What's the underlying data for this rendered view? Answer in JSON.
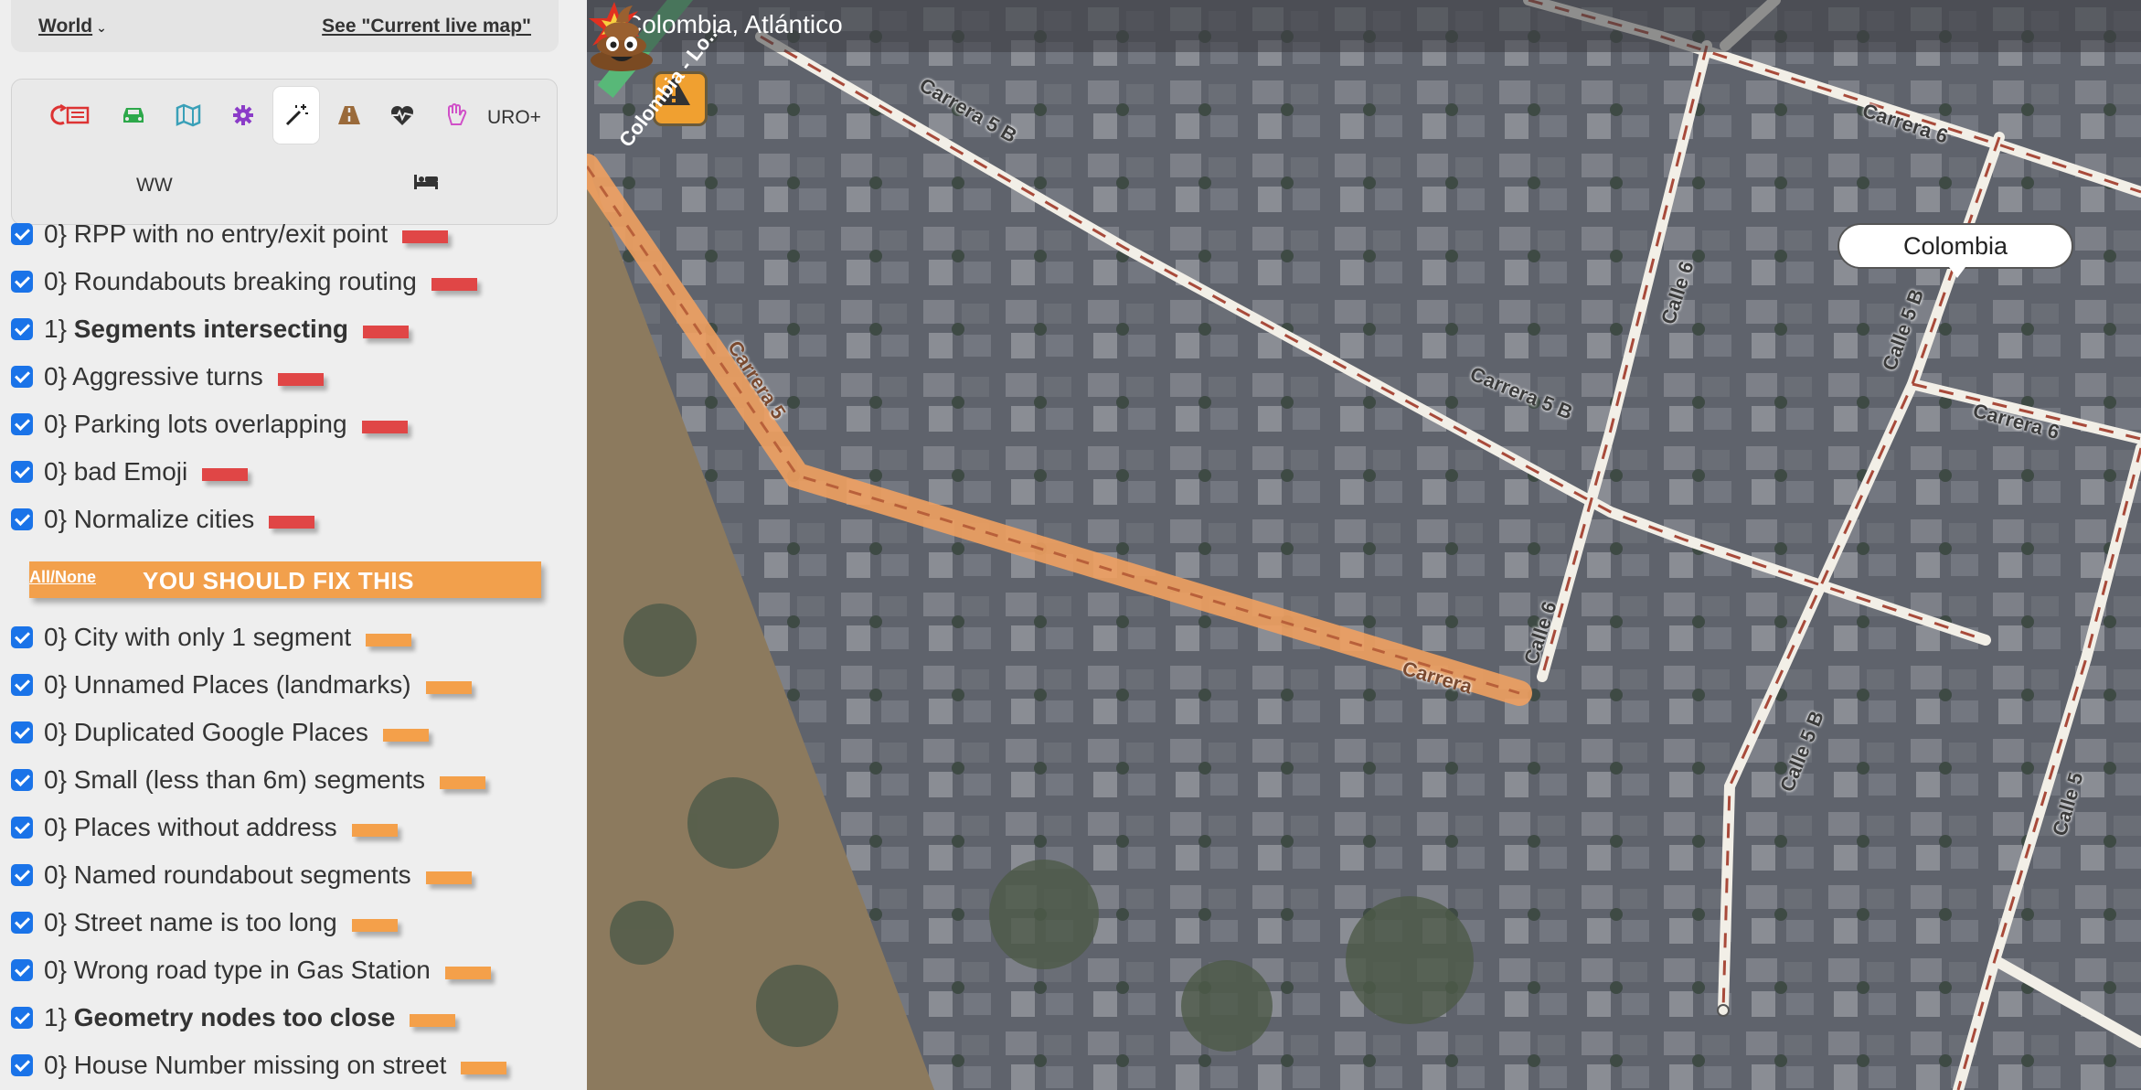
{
  "topbar": {
    "world_label": "World",
    "live_map_link": "See \"Current live map\""
  },
  "toolbar": {
    "icons": [
      "restart-icon",
      "car-icon",
      "map-icon",
      "gear-icon",
      "magic-wand-icon",
      "road-icon",
      "heartbeat-icon",
      "hand-icon"
    ],
    "uro_label": "URO+",
    "ww_label": "WW",
    "active_tool": "magic-wand-icon"
  },
  "checks": [
    {
      "label": "0} RPP with no entry/exit point",
      "bold": false,
      "color": "red"
    },
    {
      "label": "0} Roundabouts breaking routing",
      "bold": false,
      "color": "red"
    },
    {
      "label_count": "1}",
      "label": "Segments intersecting",
      "bold": true,
      "color": "red"
    },
    {
      "label": "0} Aggressive turns",
      "bold": false,
      "color": "red"
    },
    {
      "label": "0} Parking lots overlapping",
      "bold": false,
      "color": "red"
    },
    {
      "label": "0} bad Emoji",
      "bold": false,
      "color": "red"
    },
    {
      "label": "0} Normalize cities",
      "bold": false,
      "color": "red"
    }
  ],
  "fix_section": {
    "all_none": "All/None",
    "title": "YOU SHOULD FIX THIS"
  },
  "fix_checks": [
    {
      "label": "0} City with only 1 segment",
      "bold": false,
      "color": "orange"
    },
    {
      "label": "0} Unnamed Places (landmarks)",
      "bold": false,
      "color": "orange"
    },
    {
      "label": "0} Duplicated Google Places",
      "bold": false,
      "color": "orange"
    },
    {
      "label": "0} Small (less than 6m) segments",
      "bold": false,
      "color": "orange"
    },
    {
      "label": "0} Places without address",
      "bold": false,
      "color": "orange"
    },
    {
      "label": "0} Named roundabout segments",
      "bold": false,
      "color": "orange"
    },
    {
      "label": "0} Street name is too long",
      "bold": false,
      "color": "orange"
    },
    {
      "label": "0} Wrong road type in Gas Station",
      "bold": false,
      "color": "orange"
    },
    {
      "label_count": "1}",
      "label": "Geometry nodes too close",
      "bold": true,
      "color": "orange"
    },
    {
      "label": "0} House Number missing on street",
      "bold": false,
      "color": "orange"
    }
  ],
  "map": {
    "location_title": "Colombia, Atlántico",
    "country_bubble": "Colombia",
    "street_labels": [
      "Carrera 5 B",
      "Carrera 6",
      "Carrera 5 B",
      "Calle 6",
      "Calle 5 B",
      "Carrera 6",
      "Calle 6",
      "Calle 5 B",
      "Calle 5",
      "Carrera 5",
      "Carrera",
      "Colombia - Lo..."
    ]
  },
  "colors": {
    "checkbox": "#1a73e8",
    "severity_red": "#e04646",
    "severity_orange": "#f4a04a",
    "highlight_segment": "#f0a060"
  }
}
